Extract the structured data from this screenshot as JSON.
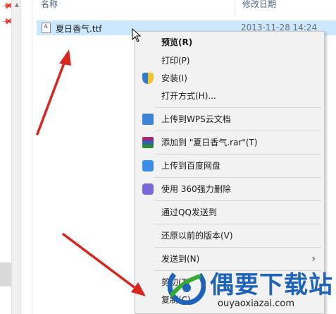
{
  "headers": {
    "name": "名称",
    "modified": "修改日期"
  },
  "file": {
    "name": "夏日香气.ttf",
    "date": "2013-11-28 14:24"
  },
  "context_menu": {
    "items": [
      {
        "label": "预览(R)",
        "icon": ""
      },
      {
        "label": "打印(P)",
        "icon": ""
      },
      {
        "label": "安装(I)",
        "icon": "shield-icon"
      },
      {
        "label": "打开方式(H)...",
        "icon": ""
      },
      {
        "label": "上传到WPS云文档",
        "icon": "wps-cloud-icon"
      },
      {
        "label": "添加到 \"夏日香气.rar\"(T)",
        "icon": "winrar-icon"
      },
      {
        "label": "上传到百度网盘",
        "icon": "baidu-netdisk-icon"
      },
      {
        "label": "使用 360强力删除",
        "icon": "360-delete-icon"
      },
      {
        "label": "通过QQ发送到",
        "icon": ""
      },
      {
        "label": "还原以前的版本(V)",
        "icon": ""
      },
      {
        "label": "发送到(N)",
        "icon": "",
        "submenu": "chevron-right-icon"
      },
      {
        "label": "剪切(T)",
        "icon": ""
      },
      {
        "label": "复制(C)",
        "icon": ""
      }
    ]
  },
  "watermark": {
    "title": "偶要下载站",
    "url": "ouyaoxiazai.com"
  },
  "colors": {
    "selection": "#cce8ff",
    "menu_bg": "#f2f2f2",
    "arrow_red": "#d7261e",
    "watermark_blue": "#1f63b8"
  }
}
